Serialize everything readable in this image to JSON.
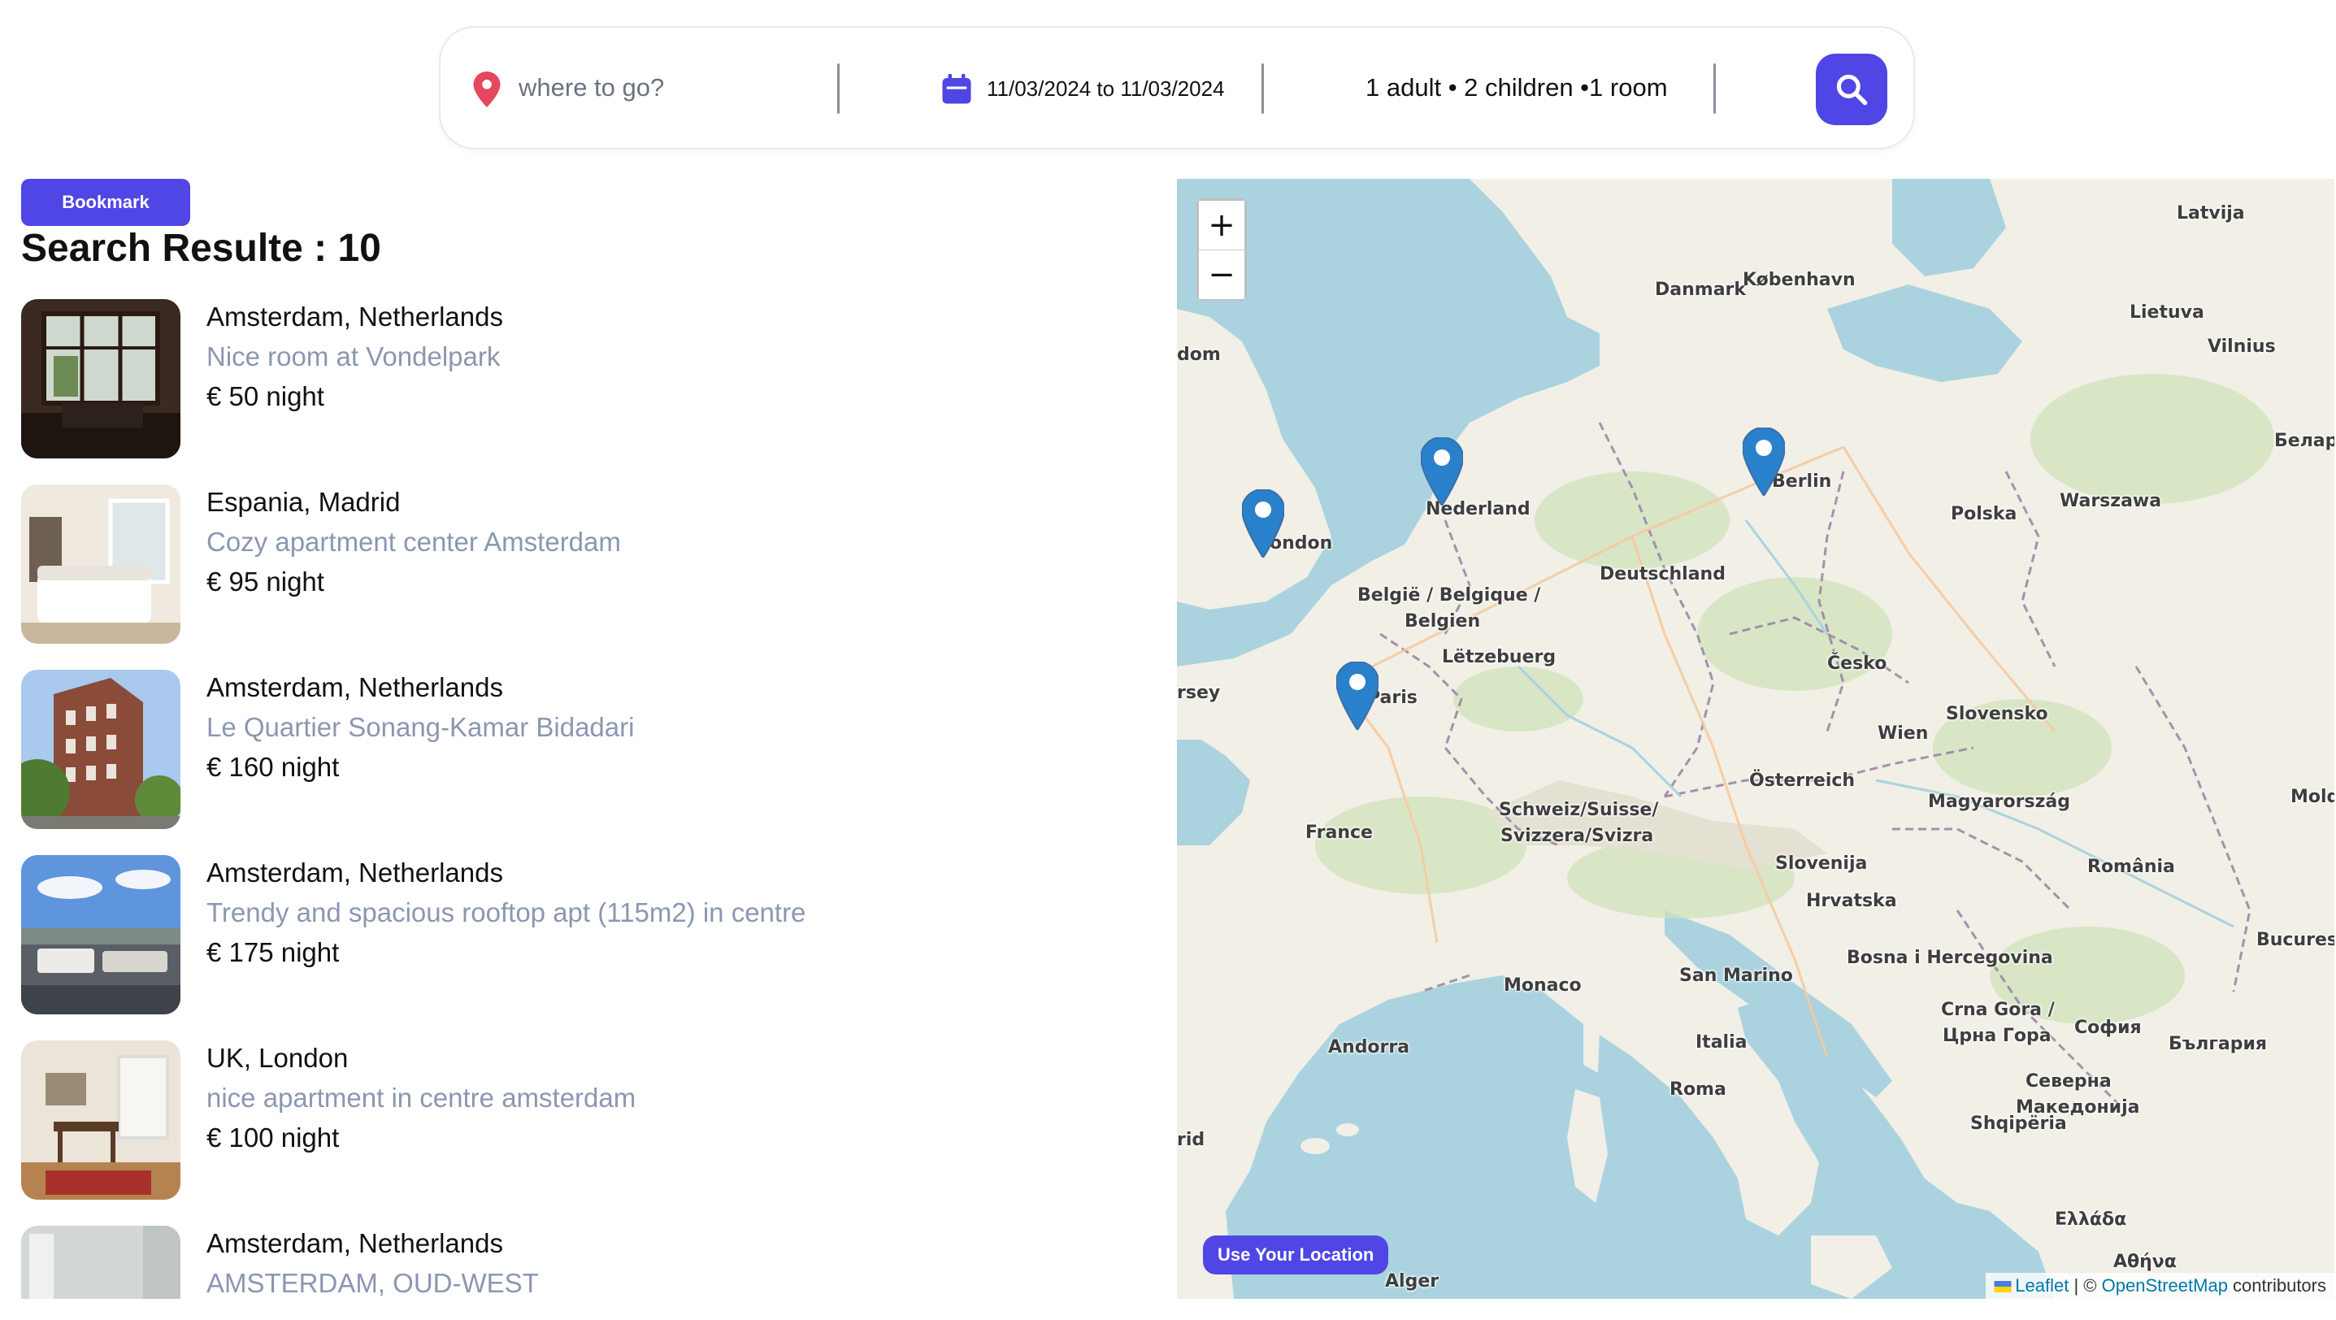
{
  "search": {
    "placeholder": "where to go?",
    "dates": "11/03/2024 to 11/03/2024",
    "guests": "1 adult • 2 children •1 room",
    "accent_color": "#4f46e5",
    "icons": {
      "location": "map-pin-icon",
      "calendar": "calendar-icon",
      "search": "search-icon"
    }
  },
  "bookmark_label": "Bookmark",
  "results_title": "Search Resulte : 10",
  "results": [
    {
      "city": "Amsterdam, Netherlands",
      "name": "Nice room at Vondelpark",
      "price": "€ 50 night"
    },
    {
      "city": "Espania, Madrid",
      "name": "Cozy apartment center Amsterdam",
      "price": "€ 95 night"
    },
    {
      "city": "Amsterdam, Netherlands",
      "name": "Le Quartier Sonang-Kamar Bidadari",
      "price": "€ 160 night"
    },
    {
      "city": "Amsterdam, Netherlands",
      "name": "Trendy and spacious rooftop apt (115m2) in centre",
      "price": "€ 175 night"
    },
    {
      "city": "UK, London",
      "name": "nice apartment in centre amsterdam",
      "price": "€ 100 night"
    },
    {
      "city": "Amsterdam, Netherlands",
      "name": "AMSTERDAM, OUD-WEST",
      "price": ""
    }
  ],
  "map": {
    "zoom_in": "+",
    "zoom_out": "−",
    "use_location": "Use Your Location",
    "attribution": {
      "leaflet": "Leaflet",
      "separator": " | © ",
      "osm": "OpenStreetMap",
      "suffix": " contributors"
    },
    "labels": {
      "latvija": "Latvija",
      "danmark": "Danmark",
      "kobenhavn": "København",
      "lietuva": "Lietuva",
      "vilnius": "Vilnius",
      "belarus": "Беларус",
      "dom": "dom",
      "nederland": "Nederland",
      "berlin": "Berlin",
      "london": "London",
      "polska": "Polska",
      "warszawa": "Warszawa",
      "deutschland": "Deutschland",
      "belgie": "België / Belgique /",
      "belgien": "Belgien",
      "letzebuerg": "Lëtzebuerg",
      "cesko": "Česko",
      "paris": "Paris",
      "wien": "Wien",
      "slovensko": "Slovensko",
      "osterreich": "Österreich",
      "magyarorszag": "Magyarország",
      "france": "France",
      "schweiz": "Schweiz/Suisse/",
      "svizzera": "Svizzera/Svizra",
      "slovenija": "Slovenija",
      "hrvatska": "Hrvatska",
      "romania": "România",
      "bosna": "Bosna i Hercegovina",
      "monaco": "Monaco",
      "san_marino": "San Marino",
      "bucuresti": "Bucuresti",
      "crna_gora": "Crna Gora /",
      "crna_gora_cyr": "Црна Гора",
      "sofia": "София",
      "bulgaria": "България",
      "andorra": "Andorra",
      "italia": "Italia",
      "roma": "Roma",
      "macedonia": "Северна",
      "macedonia2": "Македонија",
      "shqiperia": "Shqipëria",
      "ellada": "Ελλάδα",
      "athina": "Αθήνα",
      "alger": "Alger",
      "jersey": "rsey",
      "mold": "Mold",
      "rid": "rid"
    },
    "markers": [
      "amsterdam",
      "london",
      "berlin",
      "paris"
    ]
  }
}
